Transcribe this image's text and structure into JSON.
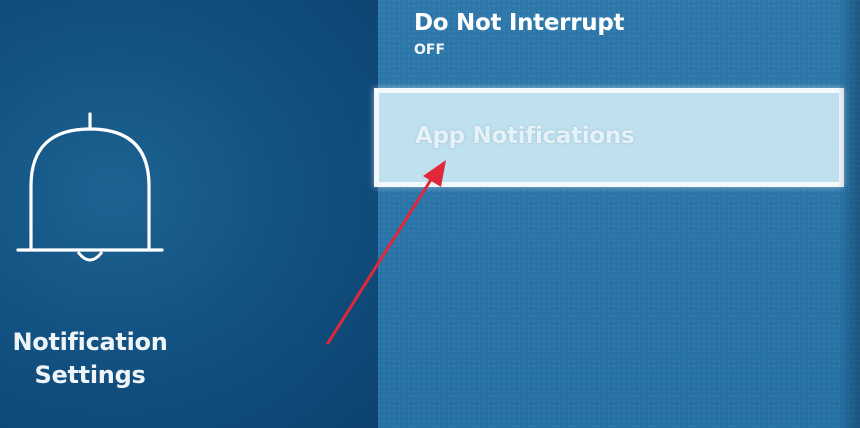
{
  "left_panel": {
    "title_line1": "Notification",
    "title_line2": "Settings",
    "icon": "bell-icon"
  },
  "menu": {
    "items": [
      {
        "label": "Do Not Interrupt",
        "value": "OFF"
      },
      {
        "label": "App Notifications",
        "focused": true
      }
    ]
  },
  "colors": {
    "focus_background": "#bfe0ee",
    "focus_border": "#f2f8fb",
    "annotation_arrow": "#e0283a"
  }
}
